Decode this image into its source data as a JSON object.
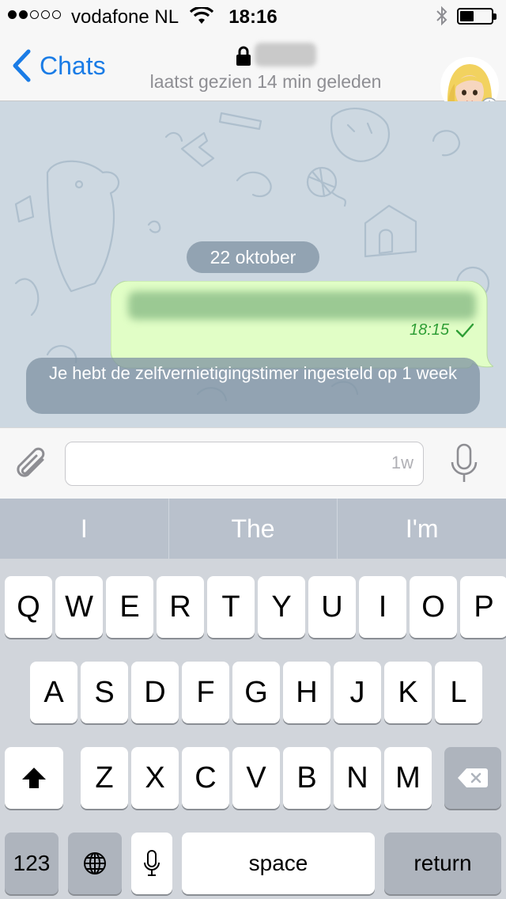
{
  "status_bar": {
    "carrier": "vodafone NL",
    "time": "18:16",
    "signal_dots_filled": 2,
    "signal_dots_total": 5,
    "battery_level": 0.4
  },
  "nav": {
    "back_label": "Chats",
    "last_seen": "laatst gezien 14 min geleden"
  },
  "chat": {
    "date_label": "22 oktober",
    "message_time": "18:15",
    "service_message": "Je hebt de zelfvernietigingstimer ingesteld op 1 week"
  },
  "input": {
    "timer_label": "1w"
  },
  "suggestions": [
    "I",
    "The",
    "I'm"
  ],
  "keyboard": {
    "row1": [
      "Q",
      "W",
      "E",
      "R",
      "T",
      "Y",
      "U",
      "I",
      "O",
      "P"
    ],
    "row2": [
      "A",
      "S",
      "D",
      "F",
      "G",
      "H",
      "J",
      "K",
      "L"
    ],
    "row3": [
      "Z",
      "X",
      "C",
      "V",
      "B",
      "N",
      "M"
    ],
    "numbers_label": "123",
    "space_label": "space",
    "return_label": "return"
  },
  "colors": {
    "accent": "#1a7ce6",
    "outgoing_bubble": "#e1fec6",
    "chat_background": "#cdd8e1",
    "check_green": "#2f9e36"
  }
}
